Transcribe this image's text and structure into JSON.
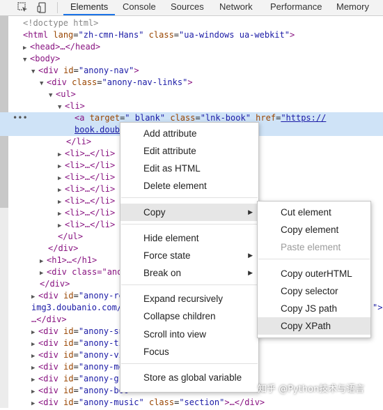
{
  "toolbar": {
    "tabs": [
      {
        "label": "Elements"
      },
      {
        "label": "Console"
      },
      {
        "label": "Sources"
      },
      {
        "label": "Network"
      },
      {
        "label": "Performance"
      },
      {
        "label": "Memory"
      }
    ],
    "icons": [
      "inspect-element-icon",
      "device-toolbar-icon"
    ]
  },
  "dom": {
    "doctype": "<!doctype html>",
    "html_tag": "html",
    "lang_attr": "lang",
    "lang_val": "\"zh-cmn-Hans\"",
    "class_attr": "class",
    "html_class_val": "\"ua-windows ua-webkit\"",
    "head": "<head>…</head>",
    "body_open": "<body>",
    "div_nav": "div",
    "id_attr": "id",
    "nav_id": "\"anony-nav\"",
    "nav_links_class": "\"anony-nav-links\"",
    "ul_open": "<ul>",
    "li_open": "<li>",
    "a_tag": "a",
    "target_attr": "target",
    "target_val": "\"_blank\"",
    "lnk_class": "\"lnk-book\"",
    "href_attr": "href",
    "href_val1": "\"https://",
    "href_val2": "book.doub",
    "li_close": "</li>",
    "li_collapsed": "<li>…</li>",
    "ul_close": "</ul>",
    "div_close": "</div>",
    "h1_collapsed": "<h1>…</h1>",
    "div_class_partial": "<div class=\"ano",
    "div_anony_re": "\"anony-re",
    "img3": "img3.doubanio.com/",
    "img3_tail": "\">",
    "div_close_collapsed": "…</div>",
    "partial_ids": [
      "\"anony-sn",
      "\"anony-ti",
      "\"anony-vi",
      "\"anony-mo",
      "\"anony-gr",
      "\"anony-boo"
    ],
    "music_id": "\"anony-music\"",
    "section_class": "\"section\"",
    "music_tail": ">…</div>",
    "dots": "•••"
  },
  "context_menu": {
    "items": [
      {
        "label": "Add attribute"
      },
      {
        "label": "Edit attribute"
      },
      {
        "label": "Edit as HTML"
      },
      {
        "label": "Delete element"
      },
      {
        "label": "Copy"
      },
      {
        "label": "Hide element"
      },
      {
        "label": "Force state"
      },
      {
        "label": "Break on"
      },
      {
        "label": "Expand recursively"
      },
      {
        "label": "Collapse children"
      },
      {
        "label": "Scroll into view"
      },
      {
        "label": "Focus"
      },
      {
        "label": "Store as global variable"
      }
    ]
  },
  "copy_submenu": {
    "items": [
      {
        "label": "Cut element"
      },
      {
        "label": "Copy element"
      },
      {
        "label": "Paste element"
      },
      {
        "label": "Copy outerHTML"
      },
      {
        "label": "Copy selector"
      },
      {
        "label": "Copy JS path"
      },
      {
        "label": "Copy XPath"
      }
    ]
  },
  "watermark": "知乎 @Python技术与语言"
}
